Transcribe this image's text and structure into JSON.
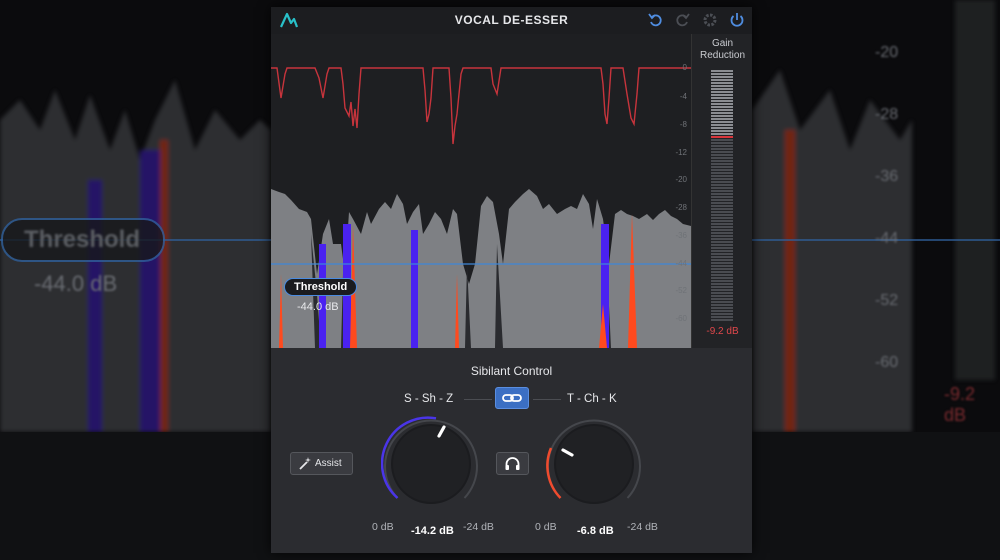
{
  "background": {
    "threshold_label": "Threshold",
    "threshold_value": "-44.0 dB",
    "scale_labels": [
      "-20",
      "-28",
      "-36",
      "-44",
      "-52",
      "-60"
    ],
    "gain_reduction_value": "-9.2 dB"
  },
  "header": {
    "title": "VOCAL DE-ESSER",
    "icons": [
      "app-logo-icon",
      "undo-icon",
      "redo-icon",
      "settings-gear-icon",
      "power-icon"
    ]
  },
  "display": {
    "scale_labels": [
      "0",
      "-4",
      "-8",
      "-12",
      "-20",
      "-28",
      "-36",
      "-44",
      "-52",
      "-60"
    ],
    "threshold_label": "Threshold",
    "threshold_value": "-44.0 dB",
    "gain_reduction_title_line1": "Gain",
    "gain_reduction_title_line2": "Reduction",
    "gain_reduction_value": "-9.2 dB",
    "colors": {
      "reduction_curve": "#c7343c",
      "signal": "#8a8c90",
      "sibilant_s": "#4a22f0",
      "sibilant_t": "#ff4a1e",
      "threshold_line": "#3f86d8"
    }
  },
  "controls": {
    "section_title": "Sibilant Control",
    "band_left_label": "S - Sh - Z",
    "band_right_label": "T - Ch - K",
    "assist_label": "Assist",
    "knob_left": {
      "min_label": "0 dB",
      "max_label": "-24 dB",
      "value": "-14.2 dB",
      "color": "#4a35e8"
    },
    "knob_right": {
      "min_label": "0 dB",
      "max_label": "-24 dB",
      "value": "-6.8 dB",
      "color": "#f04b2e"
    }
  }
}
